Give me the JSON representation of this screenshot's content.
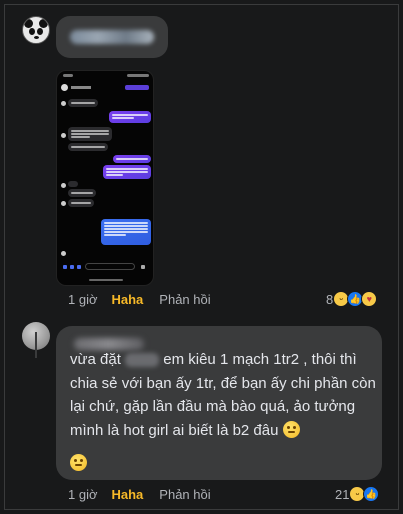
{
  "comments": [
    {
      "time": "1 giờ",
      "haha_label": "Haha",
      "reply_label": "Phản hồi",
      "reaction_count": "8"
    },
    {
      "time": "1 giờ",
      "haha_label": "Haha",
      "reply_label": "Phản hồi",
      "reaction_count": "21",
      "text_part1": "vừa đặt",
      "text_part2": "em kiêu 1 mạch 1tr2 , thôi thì chia sẻ với bạn ấy 1tr, để bạn ấy chi phần còn lại chứ, gặp lần đầu mà bào quá, ảo tưởng mình là hot girl ai biết là b2 đâu"
    }
  ],
  "icons": {
    "avatar1": "panda-avatar-icon",
    "reactions": [
      "haha-reaction-icon",
      "like-reaction-icon",
      "care-reaction-icon"
    ],
    "emoji": "thinking-face-emoji-icon"
  },
  "colors": {
    "background": "#18191a",
    "bubble": "#3a3b3c",
    "haha": "#f7b928",
    "muted": "#b0b3b8"
  }
}
